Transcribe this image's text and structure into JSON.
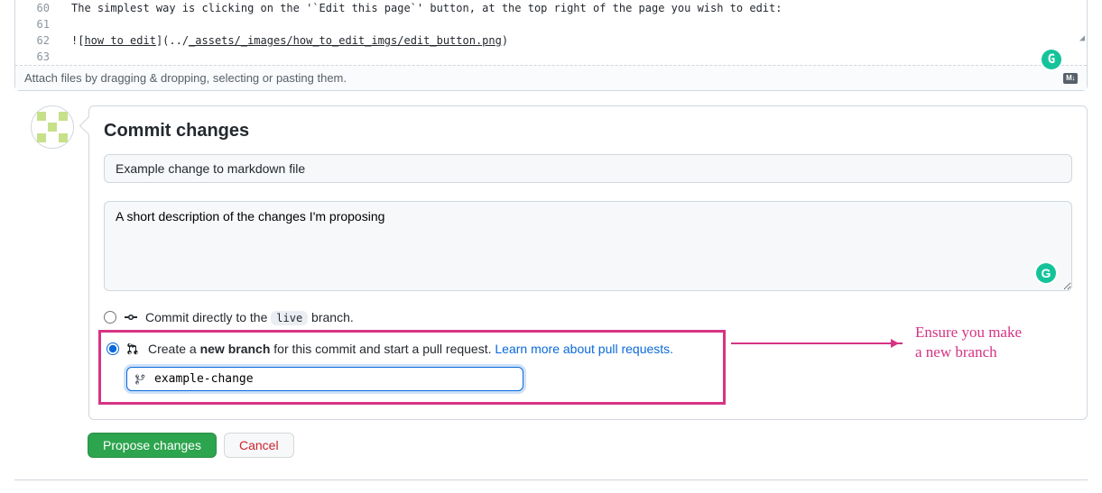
{
  "editor": {
    "lines": [
      {
        "num": "60",
        "text": "The simplest way is clicking on the '`Edit this page`' button, at the top right of the page you wish to edit:"
      },
      {
        "num": "61",
        "text": ""
      },
      {
        "num": "62",
        "text_prefix": "![",
        "text_link": "how to edit",
        "text_mid": "](../",
        "text_link2": "_assets/_images/how_to_edit_imgs/edit_button.png",
        "text_suffix": ")"
      },
      {
        "num": "63",
        "text": ""
      }
    ],
    "attach_hint": "Attach files by dragging & dropping, selecting or pasting them.",
    "md_label": "M↓"
  },
  "commit": {
    "heading": "Commit changes",
    "summary_value": "Example change to markdown file",
    "description_value": "A short description of the changes I'm proposing",
    "radio_direct_prefix": "Commit directly to the ",
    "radio_direct_branch": "live",
    "radio_direct_suffix": " branch.",
    "radio_new_prefix": "Create a ",
    "radio_new_bold": "new branch",
    "radio_new_suffix": " for this commit and start a pull request. ",
    "radio_new_link": "Learn more about pull requests.",
    "branch_name_value": "example-change"
  },
  "buttons": {
    "propose": "Propose changes",
    "cancel": "Cancel"
  },
  "annotation": {
    "line1": "Ensure you make",
    "line2": "a new branch"
  },
  "grammarly": "G"
}
